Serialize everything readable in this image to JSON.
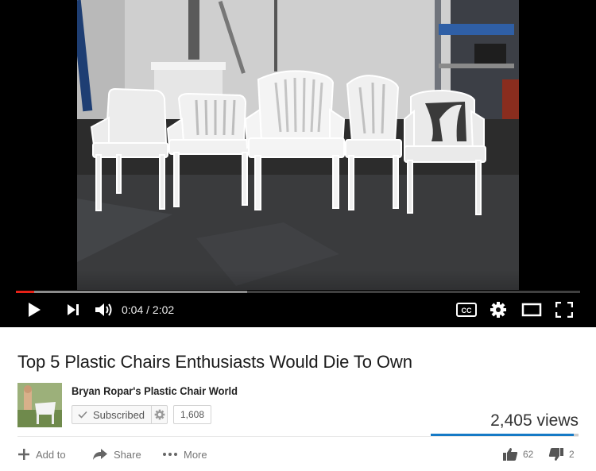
{
  "player": {
    "current_time": "0:04",
    "duration": "2:02",
    "time_separator": " / ",
    "played_fraction": 0.033,
    "loaded_fraction": 0.41,
    "accent_color": "#e62117",
    "icons": [
      "play-icon",
      "next-icon",
      "volume-icon",
      "captions-icon",
      "settings-icon",
      "theater-mode-icon",
      "fullscreen-icon"
    ],
    "captions_label": "CC"
  },
  "video": {
    "title": "Top 5 Plastic Chairs Enthusiasts Would Die To Own",
    "views": "2,405 views",
    "like_fraction": 0.97
  },
  "channel": {
    "name": "Bryan Ropar's Plastic Chair World",
    "subscribe_label": "Subscribed",
    "subscriber_count": "1,608"
  },
  "actions": {
    "add_to": "Add to",
    "share": "Share",
    "more": "More",
    "likes": "62",
    "dislikes": "2"
  },
  "colors": {
    "like_bar": "#167ac6",
    "title_text": "#1a1a1a"
  }
}
